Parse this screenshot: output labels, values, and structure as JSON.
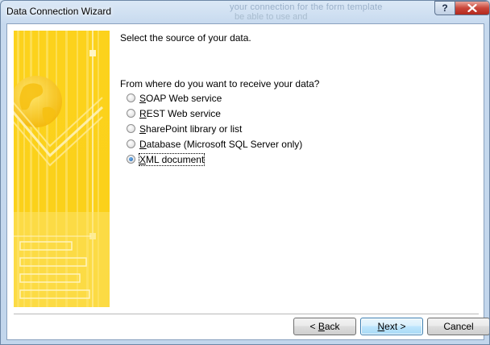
{
  "window": {
    "title": "Data Connection Wizard",
    "help_glyph": "?",
    "background_text_1": "your connection for the form template",
    "background_text_2": "be able to use and"
  },
  "content": {
    "heading": "Select the source of your data.",
    "question": "From where do you want to receive your data?",
    "options": [
      {
        "key": "S",
        "rest": "OAP Web service",
        "checked": false
      },
      {
        "key": "R",
        "rest": "EST Web service",
        "checked": false
      },
      {
        "key": "S",
        "rest": "harePoint library or list",
        "checked": false
      },
      {
        "key": "D",
        "rest": "atabase (Microsoft SQL Server only)",
        "checked": false
      },
      {
        "key": "X",
        "rest": "ML document",
        "checked": true
      }
    ]
  },
  "buttons": {
    "back": {
      "prefix": "< ",
      "key": "B",
      "rest": "ack"
    },
    "next": {
      "key": "N",
      "rest": "ext >"
    },
    "cancel": {
      "label": "Cancel"
    }
  },
  "colors": {
    "accent_yellow": "#fbd31a",
    "banner_light": "#ffe878",
    "banner_dark": "#f0b400",
    "close_red": "#c9463a"
  },
  "icons": {
    "close": "close-icon",
    "globe": "globe-icon"
  }
}
